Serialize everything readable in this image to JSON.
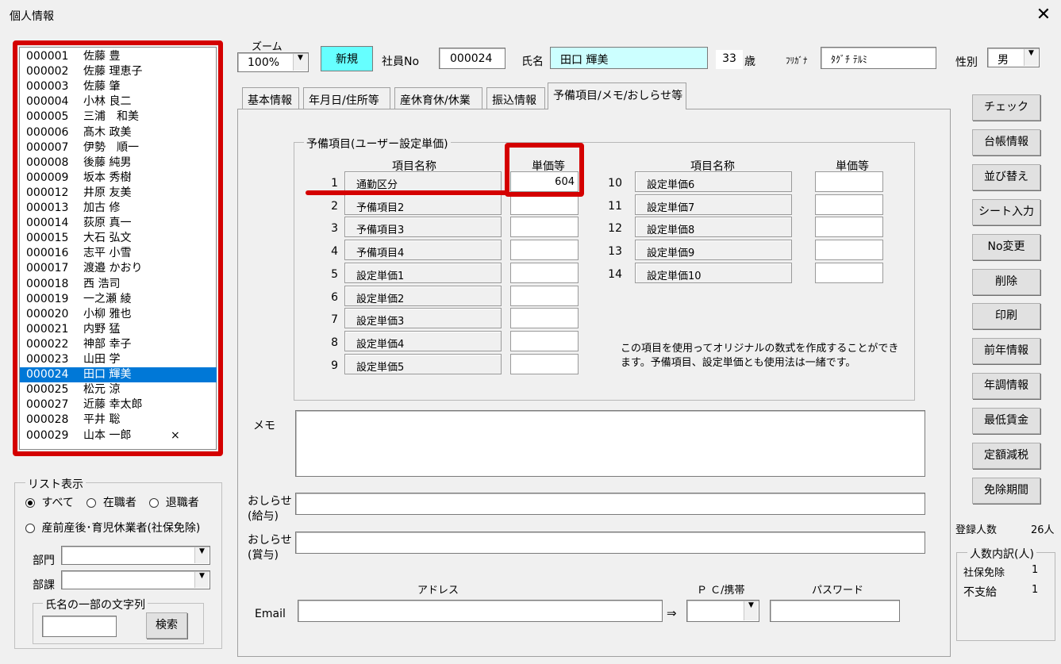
{
  "window": {
    "title": "個人情報",
    "close_glyph": "✕"
  },
  "employee_list": [
    {
      "no": "000001",
      "name": "佐藤 豊",
      "mark": ""
    },
    {
      "no": "000002",
      "name": "佐藤 理恵子",
      "mark": ""
    },
    {
      "no": "000003",
      "name": "佐藤 肇",
      "mark": ""
    },
    {
      "no": "000004",
      "name": "小林 良二",
      "mark": ""
    },
    {
      "no": "000005",
      "name": "三浦　和美",
      "mark": ""
    },
    {
      "no": "000006",
      "name": "髙木 政美",
      "mark": ""
    },
    {
      "no": "000007",
      "name": "伊勢　順一",
      "mark": ""
    },
    {
      "no": "000008",
      "name": "後藤 純男",
      "mark": ""
    },
    {
      "no": "000009",
      "name": "坂本 秀樹",
      "mark": ""
    },
    {
      "no": "000012",
      "name": "井原 友美",
      "mark": ""
    },
    {
      "no": "000013",
      "name": "加古 修",
      "mark": ""
    },
    {
      "no": "000014",
      "name": "荻原 真一",
      "mark": ""
    },
    {
      "no": "000015",
      "name": "大石 弘文",
      "mark": ""
    },
    {
      "no": "000016",
      "name": "志平 小雪",
      "mark": ""
    },
    {
      "no": "000017",
      "name": "渡邉 かおり",
      "mark": ""
    },
    {
      "no": "000018",
      "name": "西 浩司",
      "mark": ""
    },
    {
      "no": "000019",
      "name": "一之瀬 綾",
      "mark": ""
    },
    {
      "no": "000020",
      "name": "小柳 雅也",
      "mark": ""
    },
    {
      "no": "000021",
      "name": "内野 猛",
      "mark": ""
    },
    {
      "no": "000022",
      "name": "神部 幸子",
      "mark": ""
    },
    {
      "no": "000023",
      "name": "山田 学",
      "mark": ""
    },
    {
      "no": "000024",
      "name": "田口 輝美",
      "mark": ""
    },
    {
      "no": "000025",
      "name": "松元 涼",
      "mark": ""
    },
    {
      "no": "000027",
      "name": "近藤 幸太郎",
      "mark": ""
    },
    {
      "no": "000028",
      "name": "平井 聡",
      "mark": ""
    },
    {
      "no": "000029",
      "name": "山本 一郎",
      "mark": "×"
    }
  ],
  "list_display": {
    "group_label": "リスト表示",
    "options": [
      "すべて",
      "在職者",
      "退職者"
    ],
    "option_leave": "産前産後･育児休業者(社保免除)",
    "dept_label": "部門",
    "section_label": "部課",
    "name_search_label": "氏名の一部の文字列",
    "search_button": "検索"
  },
  "header": {
    "zoom_label": "ズーム",
    "zoom_value": "100%",
    "new_button": "新規",
    "emp_no_label": "社員No",
    "emp_no_value": "000024",
    "name_label": "氏名",
    "name_value": "田口 輝美",
    "age_value": "33",
    "age_unit": "歳",
    "furigana_label": "ﾌﾘｶﾞﾅ",
    "furigana_value": "ﾀｸﾞﾁ ﾃﾙﾐ",
    "gender_label": "性別",
    "gender_value": "男"
  },
  "tabs": [
    "基本情報",
    "年月日/住所等",
    "産休育休/休業",
    "振込情報",
    "予備項目/メモ/おしらせ等"
  ],
  "reserve": {
    "group_title": "予備項目(ユーザー設定単価)",
    "col_name": "項目名称",
    "col_price": "単価等",
    "left_rows": [
      {
        "num": "1",
        "name": "通勤区分",
        "value": "604"
      },
      {
        "num": "2",
        "name": "予備項目2",
        "value": ""
      },
      {
        "num": "3",
        "name": "予備項目3",
        "value": ""
      },
      {
        "num": "4",
        "name": "予備項目4",
        "value": ""
      },
      {
        "num": "5",
        "name": "設定単価1",
        "value": ""
      },
      {
        "num": "6",
        "name": "設定単価2",
        "value": ""
      },
      {
        "num": "7",
        "name": "設定単価3",
        "value": ""
      },
      {
        "num": "8",
        "name": "設定単価4",
        "value": ""
      },
      {
        "num": "9",
        "name": "設定単価5",
        "value": ""
      }
    ],
    "right_rows": [
      {
        "num": "10",
        "name": "設定単価6",
        "value": ""
      },
      {
        "num": "11",
        "name": "設定単価7",
        "value": ""
      },
      {
        "num": "12",
        "name": "設定単価8",
        "value": ""
      },
      {
        "num": "13",
        "name": "設定単価9",
        "value": ""
      },
      {
        "num": "14",
        "name": "設定単価10",
        "value": ""
      }
    ],
    "note_line1": "この項目を使用ってオリジナルの数式を作成することができ",
    "note_line2": "ます。予備項目、設定単価とも使用法は一緒です。"
  },
  "memo": {
    "label": "メモ",
    "value": ""
  },
  "notice_pay": {
    "label_line1": "おしらせ",
    "label_line2": "(給与)",
    "value": ""
  },
  "notice_bonus": {
    "label_line1": "おしらせ",
    "label_line2": "(賞与)",
    "value": ""
  },
  "email": {
    "label": "Email",
    "address_label": "アドレス",
    "arrow": "⇒",
    "device_label": "Ｐ Ｃ/携帯",
    "password_label": "パスワード",
    "address_value": "",
    "device_value": "",
    "password_value": ""
  },
  "right_buttons": [
    "チェック",
    "台帳情報",
    "並び替え",
    "シート入力",
    "No変更",
    "削除",
    "印刷",
    "前年情報",
    "年調情報",
    "最低賃金",
    "定額減税",
    "免除期間"
  ],
  "stats": {
    "registered_label": "登録人数",
    "registered_value": "26人",
    "breakdown_title": "人数内訳(人)",
    "rows": [
      {
        "label": "社保免除",
        "value": "1"
      },
      {
        "label": "不支給",
        "value": "1"
      }
    ]
  },
  "colors": {
    "highlight_red": "#d40000",
    "selection_blue": "#0078d7",
    "name_field_cyan": "#ccffff",
    "new_button_cyan": "#66ffff"
  }
}
